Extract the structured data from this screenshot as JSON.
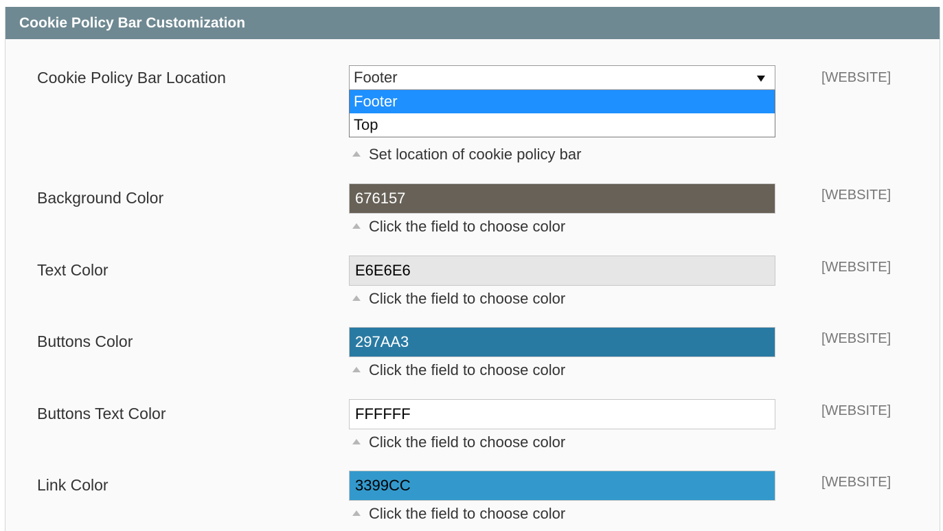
{
  "section": {
    "title": "Cookie Policy Bar Customization"
  },
  "location": {
    "label": "Cookie Policy Bar Location",
    "selected": "Footer",
    "options": [
      "Footer",
      "Top"
    ],
    "hint": "Set location of cookie policy bar",
    "scope": "[WEBSITE]"
  },
  "fields": [
    {
      "label": "Background Color",
      "value": "676157",
      "bg": "#676157",
      "fg": "#ffffff",
      "hint": "Click the field to choose color",
      "scope": "[WEBSITE]"
    },
    {
      "label": "Text Color",
      "value": "E6E6E6",
      "bg": "#E6E6E6",
      "fg": "#000000",
      "hint": "Click the field to choose color",
      "scope": "[WEBSITE]"
    },
    {
      "label": "Buttons Color",
      "value": "297AA3",
      "bg": "#297AA3",
      "fg": "#ffffff",
      "hint": "Click the field to choose color",
      "scope": "[WEBSITE]"
    },
    {
      "label": "Buttons Text Color",
      "value": "FFFFFF",
      "bg": "#FFFFFF",
      "fg": "#000000",
      "hint": "Click the field to choose color",
      "scope": "[WEBSITE]"
    },
    {
      "label": "Link Color",
      "value": "3399CC",
      "bg": "#3399CC",
      "fg": "#000000",
      "hint": "Click the field to choose color",
      "scope": "[WEBSITE]"
    }
  ],
  "colors": {
    "header_bg": "#6f8992",
    "option_highlight": "#1e90ff"
  }
}
